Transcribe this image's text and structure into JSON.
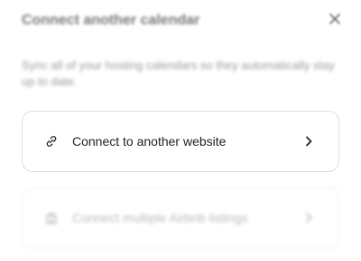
{
  "dialog": {
    "title": "Connect another calendar",
    "description": "Sync all of your hosting calendars so they automatically stay up to date.",
    "options": [
      {
        "label": "Connect to another website",
        "icon": "link-icon"
      },
      {
        "label": "Connect multiple Airbnb listings",
        "icon": "building-icon"
      }
    ]
  }
}
